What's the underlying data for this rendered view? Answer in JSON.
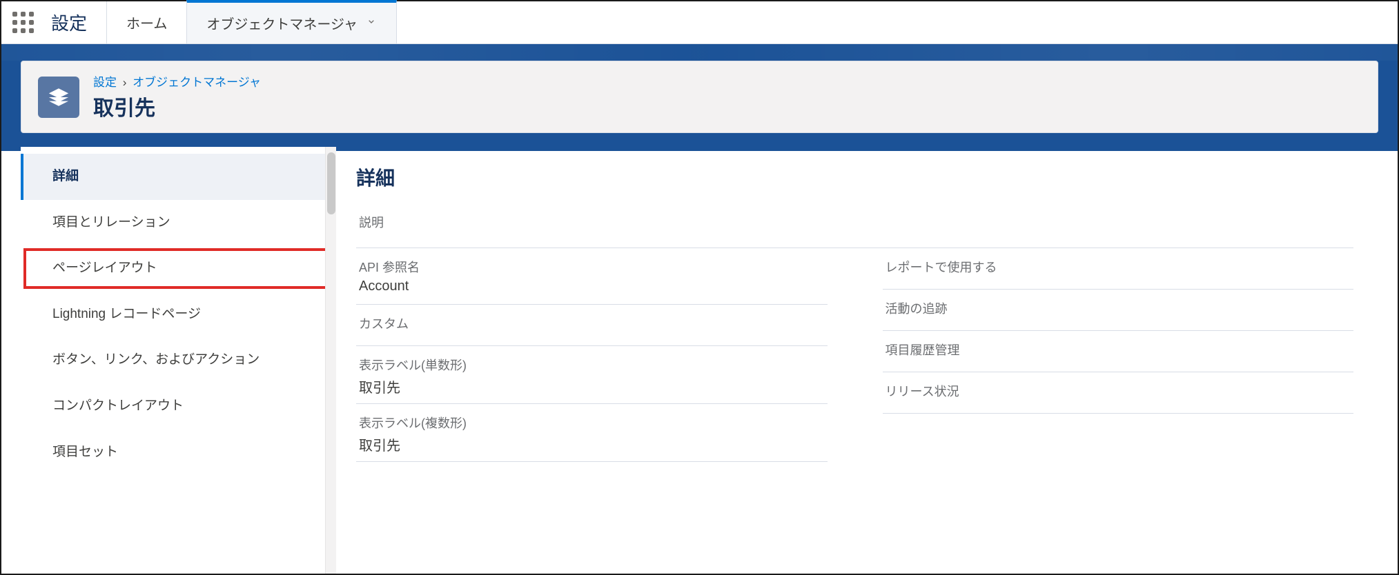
{
  "nav": {
    "app_name": "設定",
    "tabs": [
      {
        "label": "ホーム"
      },
      {
        "label": "オブジェクトマネージャ"
      }
    ]
  },
  "header": {
    "breadcrumb": {
      "root": "設定",
      "second": "オブジェクトマネージャ"
    },
    "title": "取引先"
  },
  "sidebar": {
    "items": [
      {
        "label": "詳細",
        "active": true,
        "highlight": false
      },
      {
        "label": "項目とリレーション",
        "active": false,
        "highlight": false
      },
      {
        "label": "ページレイアウト",
        "active": false,
        "highlight": true
      },
      {
        "label": "Lightning レコードページ",
        "active": false,
        "highlight": false
      },
      {
        "label": "ボタン、リンク、およびアクション",
        "active": false,
        "highlight": false
      },
      {
        "label": "コンパクトレイアウト",
        "active": false,
        "highlight": false
      },
      {
        "label": "項目セット",
        "active": false,
        "highlight": false
      }
    ]
  },
  "main": {
    "heading": "詳細",
    "description_label": "説明",
    "left_fields": [
      {
        "label": "API 参照名",
        "value": "Account"
      },
      {
        "label": "カスタム",
        "value": ""
      },
      {
        "label": "表示ラベル(単数形)",
        "value": "取引先"
      },
      {
        "label": "表示ラベル(複数形)",
        "value": "取引先"
      }
    ],
    "right_fields": [
      {
        "label": "レポートで使用する",
        "value": ""
      },
      {
        "label": "活動の追跡",
        "value": ""
      },
      {
        "label": "項目履歴管理",
        "value": ""
      },
      {
        "label": "リリース状況",
        "value": ""
      }
    ]
  }
}
